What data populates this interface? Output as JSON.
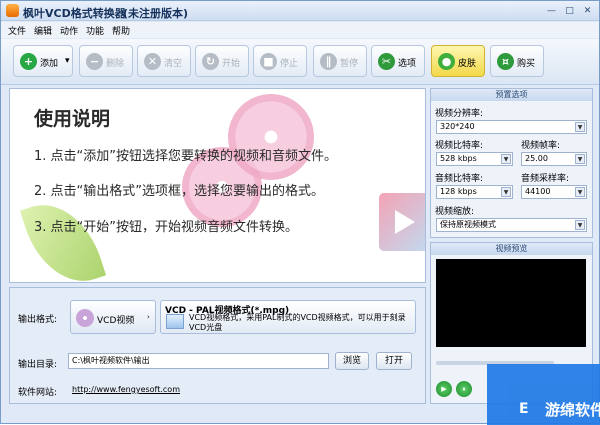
{
  "window": {
    "title": "枫叶VCD格式转换器",
    "subtitle": "(未注册版本)",
    "minimize": "—",
    "maximize": "□",
    "close": "✕"
  },
  "menu": [
    "文件",
    "编辑",
    "动作",
    "功能",
    "帮助"
  ],
  "toolbar": {
    "add": "添加",
    "add_dropdown": "▾",
    "delete": "删除",
    "clear": "清空",
    "start": "开始",
    "stop": "停止",
    "pause": "暂停",
    "options": "选项",
    "skin": "皮肤",
    "buy": "购买",
    "icons": [
      "plus-icon",
      "minus-icon",
      "clear-icon",
      "refresh-icon",
      "stop-icon",
      "pause-icon",
      "tools-icon",
      "apple-icon",
      "cart-icon"
    ]
  },
  "usage": {
    "title": "使用说明",
    "steps": [
      "1. 点击“添加”按钮选择您要转换的视频和音频文件。",
      "2. 点击“输出格式”选项框，选择您要输出的格式。",
      "3. 点击“开始”按钮，开始视频音频文件转换。"
    ]
  },
  "output": {
    "format_label": "输出格式:",
    "format_value": "VCD视频",
    "format_title": "VCD - PAL视频格式(*.mpg)",
    "format_desc": "VCD视频格式，采用PAL制式的VCD视频格式，可以用于刻录VCD光盘",
    "dir_label": "输出目录:",
    "dir_value": "C:\\枫叶视频软件\\输出",
    "browse": "浏览",
    "open": "打开",
    "site_label": "软件网站:",
    "site_url": "http://www.fengyesoft.com"
  },
  "preset": {
    "header": "预置选项",
    "resolution_label": "视频分辨率:",
    "resolution": "320*240",
    "vbitrate_label": "视频比特率:",
    "vbitrate": "528 kbps",
    "framerate_label": "视频帧率:",
    "framerate": "25.00",
    "abitrate_label": "音频比特率:",
    "abitrate": "128 kbps",
    "samplerate_label": "音频采样率:",
    "samplerate": "44100",
    "zoom_label": "视频缩放:",
    "zoom": "保持原视频模式"
  },
  "preview": {
    "header": "视频预览",
    "play": "▶",
    "pause": "⏸"
  },
  "watermark": {
    "icon": "E",
    "text": "游绵软件"
  }
}
